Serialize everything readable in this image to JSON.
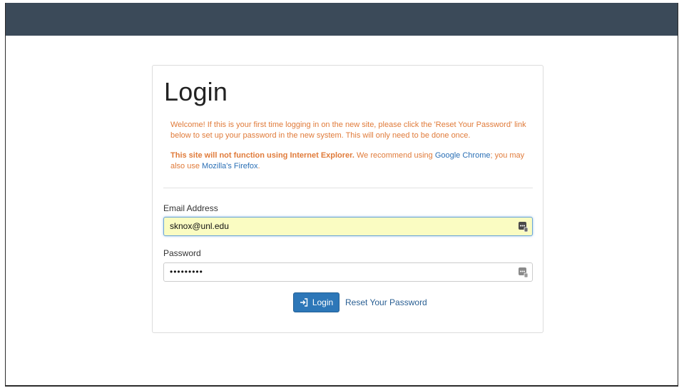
{
  "page": {
    "title": "Login"
  },
  "notice": {
    "welcome": "Welcome! If this is your first time logging in on the new site, please click the 'Reset Your Password' link below to set up your password in the new system. This will only need to be done once.",
    "ie_warning_bold": "This site will not function using Internet Explorer.",
    "ie_warning_text": " We recommend using ",
    "chrome_link": "Google Chrome",
    "middle_text": "; you may also use ",
    "firefox_link": "Mozilla's Firefox",
    "end_text": "."
  },
  "form": {
    "email_label": "Email Address",
    "email_value": "sknox@unl.edu",
    "password_label": "Password",
    "password_value": "•••••••••",
    "login_button": "Login",
    "reset_link": "Reset Your Password"
  },
  "colors": {
    "topbar": "#3b4a59",
    "notice_text": "#e07b3a",
    "link": "#2a6fb5",
    "button": "#2d77b8",
    "autofill_bg": "#fafcc2"
  },
  "icons": {
    "login_icon": "sign-in-icon",
    "email_field_icon": "password-manager-icon",
    "password_field_icon": "password-manager-icon"
  }
}
